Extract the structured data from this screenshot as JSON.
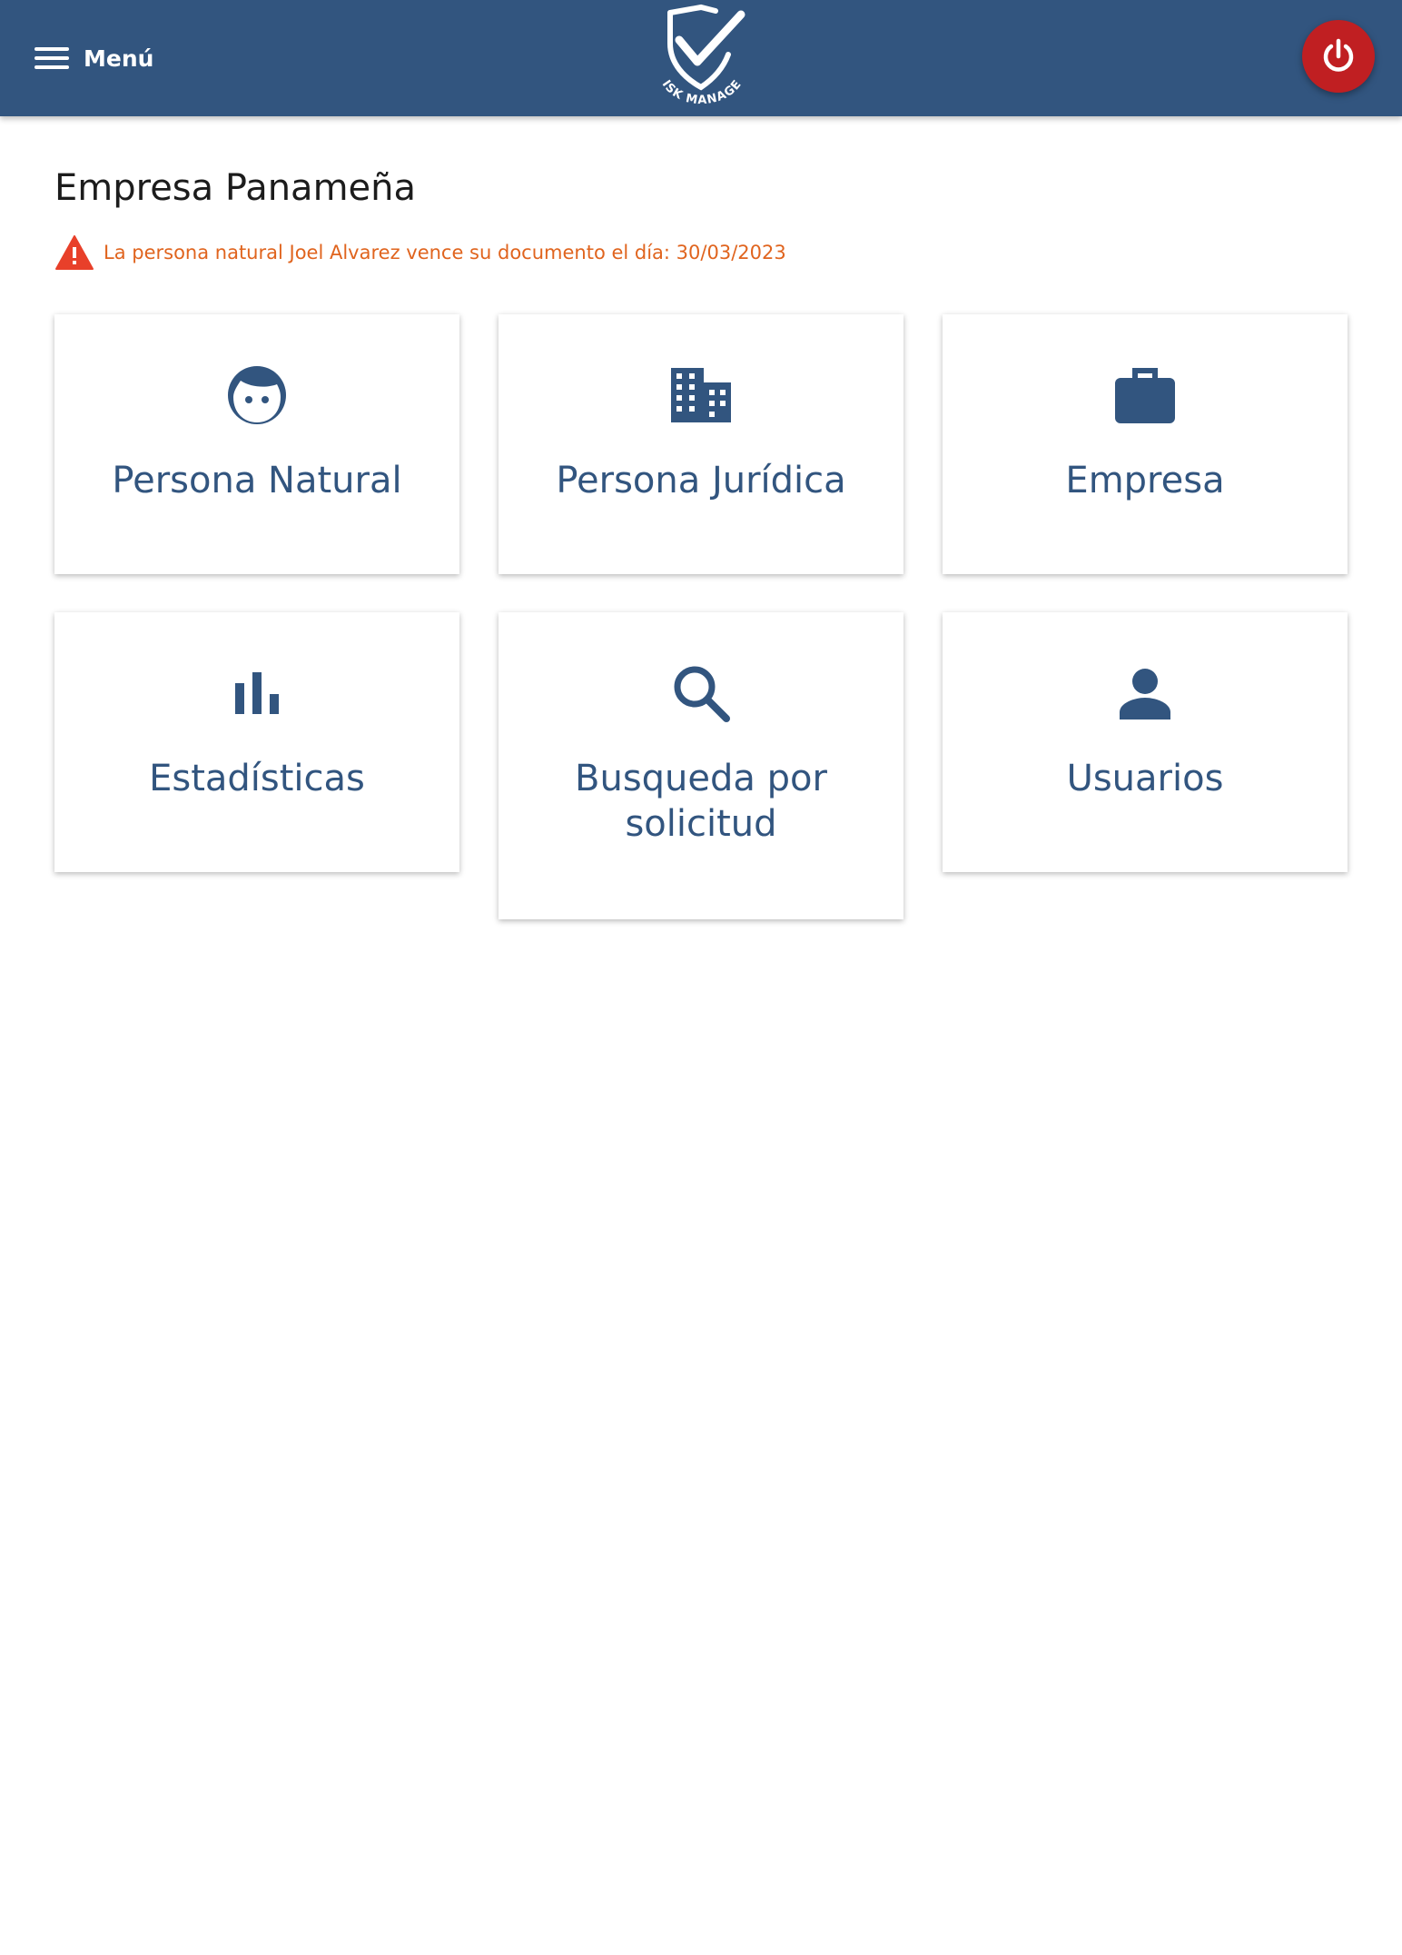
{
  "header": {
    "menu_label": "Menú",
    "logo_text": "RISK MANAGER",
    "power_icon": "power-icon"
  },
  "main": {
    "title": "Empresa Panameña",
    "alert": {
      "icon": "warning-icon",
      "text": "La persona natural Joel Alvarez vence su documento el día: 30/03/2023"
    },
    "cards": [
      {
        "label": "Persona Natural",
        "icon": "face-icon"
      },
      {
        "label": "Persona Jurídica",
        "icon": "building-icon"
      },
      {
        "label": "Empresa",
        "icon": "briefcase-icon"
      },
      {
        "label": "Estadísticas",
        "icon": "bar-chart-icon"
      },
      {
        "label": "Busqueda por solicitud",
        "icon": "search-icon"
      },
      {
        "label": "Usuarios",
        "icon": "person-icon"
      }
    ]
  },
  "colors": {
    "appbar": "#32557f",
    "accent": "#32557f",
    "power_button": "#c01f22",
    "alert_text": "#e0641e",
    "alert_icon": "#e8402a"
  }
}
